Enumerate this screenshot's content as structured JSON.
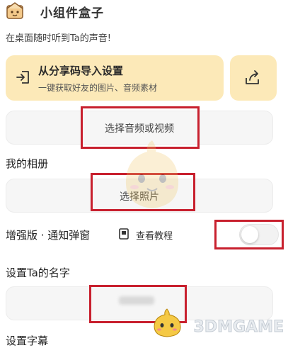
{
  "header": {
    "app_title": "小组件盒子",
    "subtitle": "在桌面随时听到Ta的声音!"
  },
  "import_banner": {
    "title": "从分享码导入设置",
    "subtitle": "一键获取好友的图片、音频素材",
    "icon": "import-icon"
  },
  "share_button": {
    "icon": "share-icon"
  },
  "audio_field": {
    "label": "选择音频或视频"
  },
  "album_section": {
    "label": "我的相册"
  },
  "photo_field": {
    "label": "选择照片"
  },
  "notify_section": {
    "label": "增强版 · 通知弹窗",
    "tutorial_label": "查看教程",
    "toggle_on": false
  },
  "name_section": {
    "label": "设置Ta的名字"
  },
  "subtitle_section": {
    "label": "设置字幕"
  },
  "watermark": {
    "text": "3DMGAME"
  },
  "colors": {
    "banner_bg": "#fce9b8",
    "field_bg": "#f6f6f6",
    "annotation_red": "#c8202e"
  }
}
